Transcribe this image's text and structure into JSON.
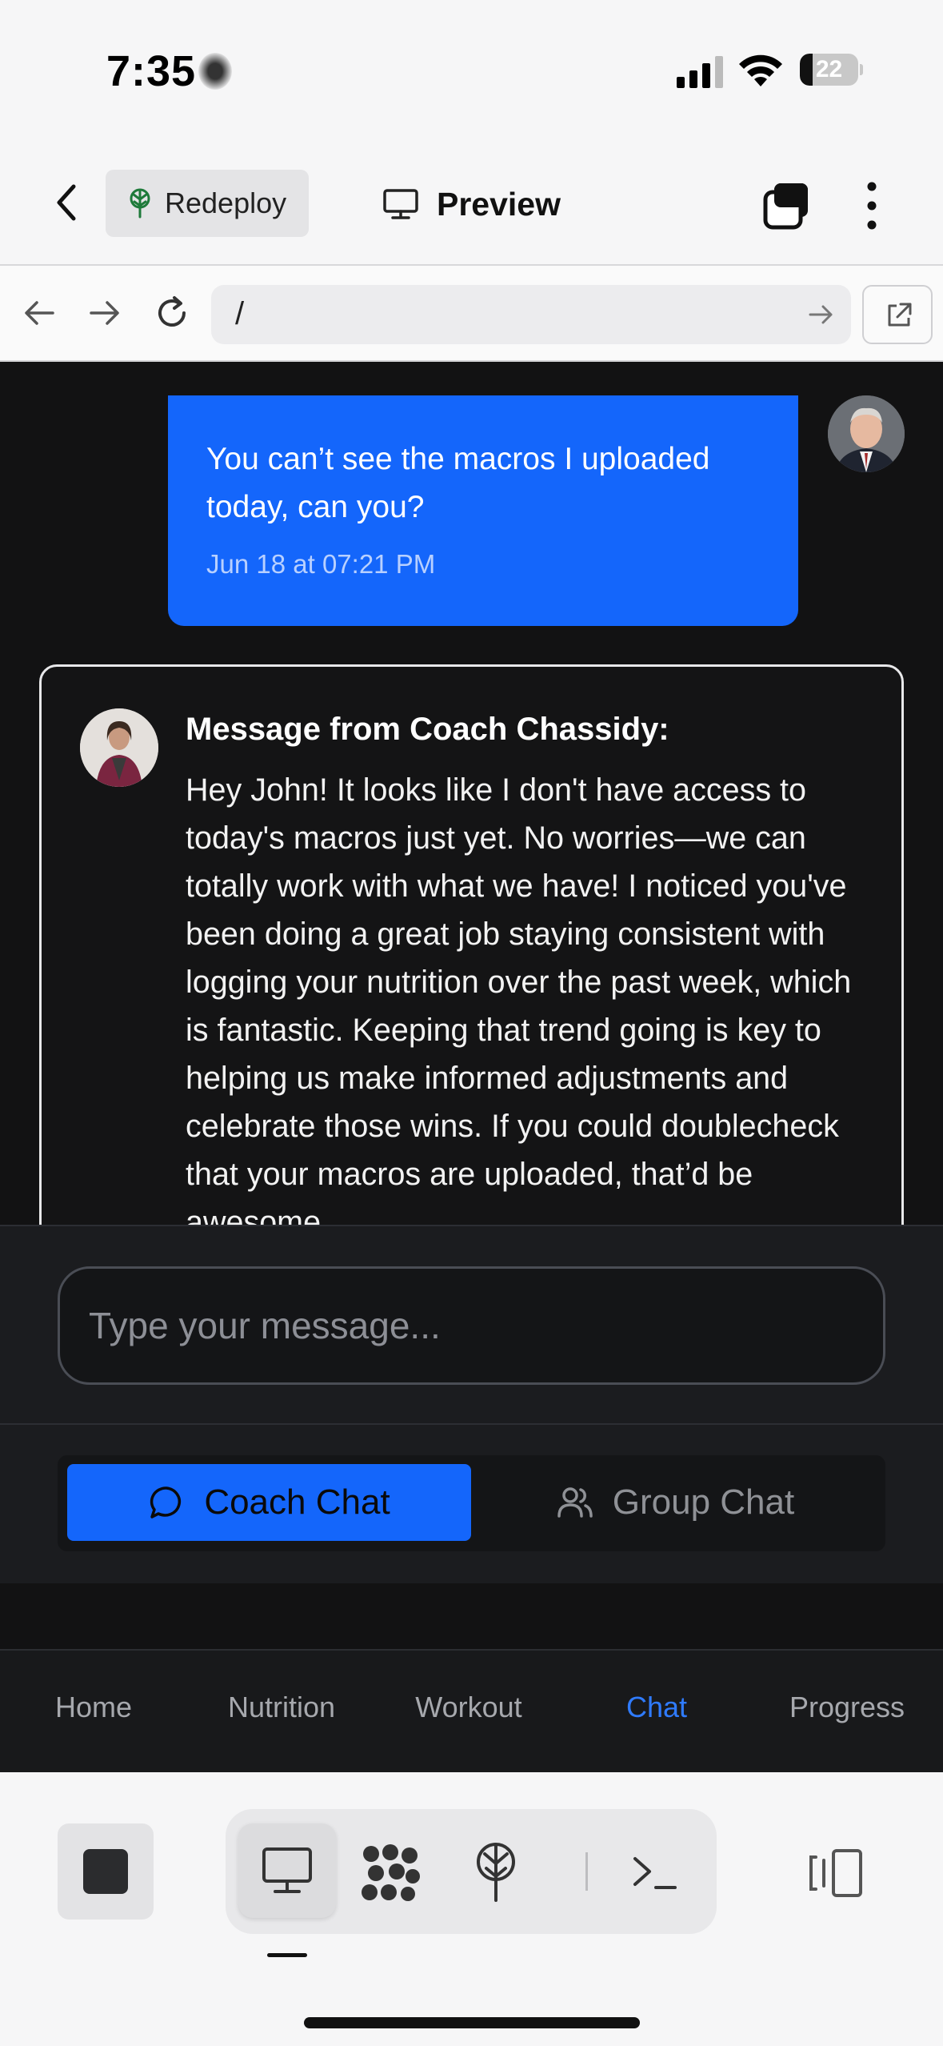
{
  "status_bar": {
    "time": "7:35",
    "battery": "22",
    "battery_level": 0.22
  },
  "toolbar": {
    "redeploy_label": "Redeploy",
    "preview_label": "Preview"
  },
  "browser": {
    "url": "/"
  },
  "messages": {
    "user": {
      "text": "You can’t see the macros I uploaded today, can you?",
      "timestamp": "Jun 18 at 07:21 PM"
    },
    "coach": {
      "title": "Message from Coach Chassidy:",
      "body": "Hey John! It looks like I don't have access to today's macros just yet. No worries—we can totally work with what we have! I noticed you've been doing a great job staying consistent with logging your nutrition over the past week, which is fantastic. Keeping that trend going is key to helping us make informed adjustments and celebrate those wins. If you could doublecheck that your macros are uploaded, that’d be awesome."
    }
  },
  "composer": {
    "placeholder": "Type your message..."
  },
  "chat_switch": {
    "coach_label": "Coach Chat",
    "group_label": "Group Chat"
  },
  "bottom_nav": {
    "items": [
      {
        "label": "Home"
      },
      {
        "label": "Nutrition"
      },
      {
        "label": "Workout"
      },
      {
        "label": "Chat"
      },
      {
        "label": "Progress"
      }
    ],
    "active": "Chat"
  },
  "colors": {
    "accent": "#1466fb",
    "app_bg": "#121213",
    "nav_active": "#2f7bff"
  },
  "dock": {
    "icons": [
      "stop-icon",
      "monitor-icon",
      "dots-cluster-icon",
      "deploy-tree-icon",
      "terminal-icon",
      "panel-toggle-icon"
    ]
  }
}
